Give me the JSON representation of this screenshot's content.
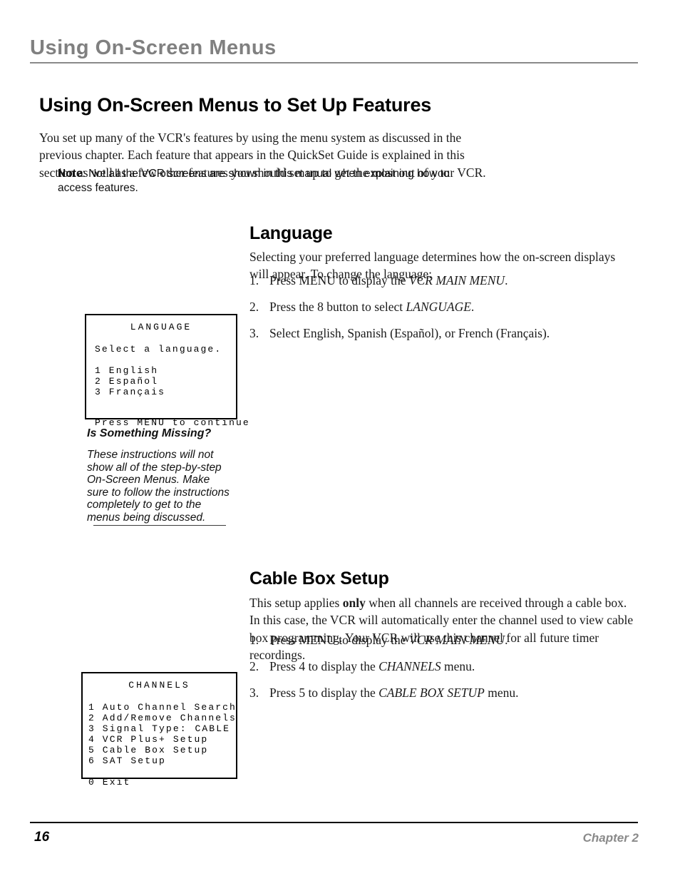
{
  "running_header": {
    "text": "Using On-Screen Menus"
  },
  "page_title": "Using On-Screen Menus to Set Up Features",
  "intro_paragraph": "You set up many of the VCR's features by using the menu system as discussed in the previous chapter. Each feature that appears in the QuickSet Guide is explained in this section as well as a few other features you should set up to get the most out of your VCR.",
  "note": {
    "label": "Note",
    "text": ": Not all the VCR screens are shown in this manual when explaining how to access features."
  },
  "sections": {
    "language": {
      "heading": "Language",
      "paragraph": "Selecting your preferred language determines how the on-screen displays will appear. To change the language:",
      "steps": [
        {
          "number": "1.",
          "text_before": "Press MENU to display the ",
          "emphasis": "VCR MAIN MENU",
          "text_after": "."
        },
        {
          "number": "2.",
          "text_before": "Press the 8 button to select ",
          "emphasis": "LANGUAGE",
          "text_after": "."
        },
        {
          "number": "3.",
          "text_before": "Select English, Spanish (Español), or French (Français).",
          "emphasis": "",
          "text_after": ""
        }
      ]
    },
    "cable_box": {
      "heading": "Cable Box Setup",
      "paragraph_part1": "This setup applies ",
      "paragraph_bold": "only",
      "paragraph_part2": " when all channels are received through a cable box. In this case, the VCR will automatically enter the channel used to view cable box programming. Your VCR will use this channel for all future timer recordings.",
      "steps": [
        {
          "number": "1.",
          "text_before": "Press MENU to display the ",
          "emphasis": "VCR MAIN MENU",
          "text_after": "."
        },
        {
          "number": "2.",
          "text_before": "Press 4 to display the ",
          "emphasis": "CHANNELS",
          "text_after": " menu."
        },
        {
          "number": "3.",
          "text_before": "Press 5 to display the ",
          "emphasis": "CABLE BOX SETUP",
          "text_after": " menu."
        }
      ]
    }
  },
  "osd_screens": {
    "language": {
      "title": "LANGUAGE",
      "prompt": "Select a language.",
      "options": [
        "1 English",
        "2 Español",
        "3 Français"
      ],
      "footer": "Press MENU to continue"
    },
    "channels": {
      "title": "CHANNELS",
      "options": [
        "1 Auto Channel Search",
        "2 Add/Remove Channels"
      ],
      "signal_type_label": "3 Signal Type:",
      "signal_type_value": "CABLE",
      "options_after": [
        "4 VCR Plus+ Setup",
        "5 Cable Box Setup",
        "6 SAT Setup"
      ],
      "exit": "0 Exit"
    }
  },
  "sidebar_callout": {
    "title": "Is Something Missing?",
    "body": "These instructions will not show all of the step-by-step On-Screen Menus. Make sure to follow the instructions completely to get to the menus being discussed."
  },
  "footer": {
    "page_number": "16",
    "chapter": "Chapter 2"
  },
  "colors": {
    "header_gray": "#808080",
    "footer_gray": "#8a8a8a",
    "text_black": "#000000"
  }
}
